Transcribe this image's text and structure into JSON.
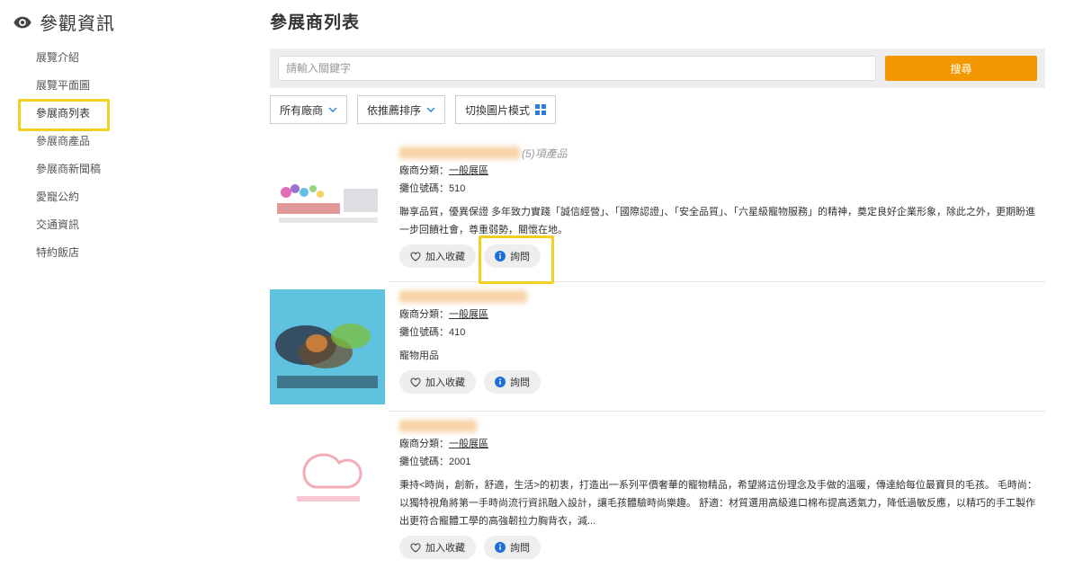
{
  "sidebar": {
    "title": "參觀資訊",
    "items": [
      {
        "label": "展覽介紹"
      },
      {
        "label": "展覽平面圖"
      },
      {
        "label": "參展商列表"
      },
      {
        "label": "參展商產品"
      },
      {
        "label": "參展商新聞稿"
      },
      {
        "label": "愛寵公約"
      },
      {
        "label": "交通資訊"
      },
      {
        "label": "特約飯店"
      }
    ],
    "active_index": 2
  },
  "main": {
    "title": "參展商列表",
    "search": {
      "placeholder": "請輸入關鍵字",
      "value": "",
      "button_label": "搜尋"
    },
    "filters": {
      "vendor_label": "所有廠商",
      "sort_label": "依推薦排序",
      "view_toggle_label": "切換圖片模式"
    },
    "exhibitors": [
      {
        "product_count": "(5)項產品",
        "category_label": "廠商分類：",
        "category_value": "一般展區",
        "booth_label": "攤位號碼：",
        "booth_value": "510",
        "description": "聯享品質，優異保證 多年致力實踐「誠信經營」、「國際認證」、「安全品質」、「六星級寵物服務」的精神，奠定良好企業形象，除此之外，更期盼進一步回饋社會，尊重弱勢，關懷在地。",
        "favorite_label": "加入收藏",
        "inquiry_label": "詢問"
      },
      {
        "product_count": "",
        "category_label": "廠商分類：",
        "category_value": "一般展區",
        "booth_label": "攤位號碼：",
        "booth_value": "410",
        "description": "寵物用品",
        "favorite_label": "加入收藏",
        "inquiry_label": "詢問"
      },
      {
        "product_count": "",
        "category_label": "廠商分類：",
        "category_value": "一般展區",
        "booth_label": "攤位號碼：",
        "booth_value": "2001",
        "description": "秉持<時尚，創新，舒適，生活>的初衷，打造出一系列平價奢華的寵物精品，希望將這份理念及手做的溫暖，傳達給每位最寶貝的毛孩。 毛時尚：以獨特視角將第一手時尚流行資訊融入設計，讓毛孩體驗時尚樂趣。 舒適：材質選用高級進口棉布提高透氣力，降低過敏反應，以精巧的手工製作出更符合寵體工學的高強韌拉力胸背衣，減...",
        "favorite_label": "加入收藏",
        "inquiry_label": "詢問"
      }
    ]
  },
  "colors": {
    "accent": "#f39800",
    "highlight": "#f5cf1f",
    "info_icon": "#1e6fd9",
    "grid_icon": "#2a7de1"
  }
}
